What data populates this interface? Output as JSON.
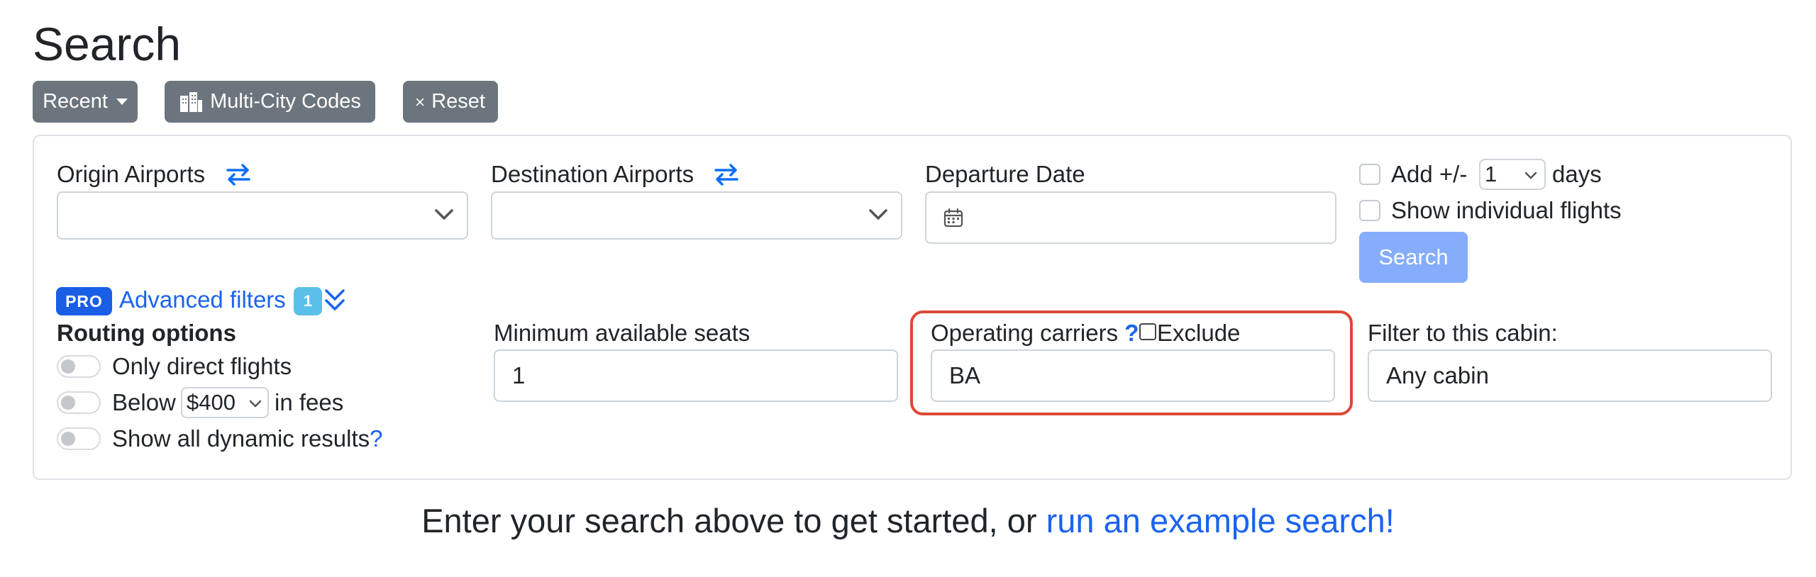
{
  "page": {
    "title": "Search"
  },
  "toolbar": {
    "recent_label": "Recent",
    "multicity_label": "Multi-City Codes",
    "reset_label": "Reset"
  },
  "form": {
    "origin_label": "Origin Airports",
    "origin_value": "",
    "destination_label": "Destination Airports",
    "destination_value": "",
    "departure_label": "Departure Date",
    "departure_value": "",
    "add_days_prefix": "Add +/-",
    "add_days_value": "1",
    "add_days_suffix": "days",
    "show_individual_label": "Show individual flights",
    "search_label": "Search"
  },
  "advanced": {
    "pro_badge": "PRO",
    "link_label": "Advanced filters",
    "count": "1",
    "routing_heading": "Routing options",
    "only_direct_label": "Only direct flights",
    "below_prefix": "Below",
    "below_value": "$400",
    "below_suffix": "in fees",
    "show_dynamic_label": "Show all dynamic results",
    "help_q": "?",
    "min_seats_label": "Minimum available seats",
    "min_seats_value": "1",
    "carriers_label": "Operating carriers",
    "carriers_help": "?",
    "exclude_label": "Exclude",
    "carriers_value": "BA",
    "cabin_label": "Filter to this cabin:",
    "cabin_value": "Any cabin"
  },
  "footer": {
    "prompt_text": "Enter your search above to get started, or ",
    "example_link": "run an example search!"
  },
  "colors": {
    "primary": "#0d6efd",
    "secondary_btn": "#6c757d",
    "highlight": "#dc4a36",
    "info_badge": "#5bc0e8"
  }
}
